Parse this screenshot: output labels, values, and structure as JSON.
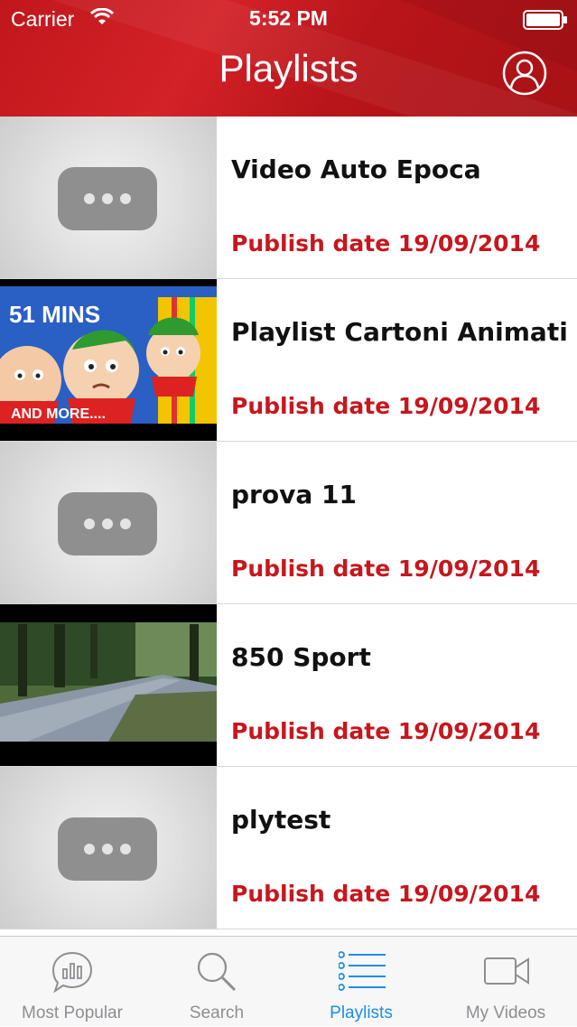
{
  "status_bar": {
    "carrier": "Carrier",
    "time": "5:52 PM"
  },
  "header": {
    "title": "Playlists",
    "profile_icon": "user-circle-icon"
  },
  "colors": {
    "accent": "#c8161d",
    "header": "#c0171c",
    "tab_active": "#1a8ee6",
    "tab_inactive": "#8e8e93"
  },
  "playlists": [
    {
      "title": "Video Auto Epoca",
      "date": "Publish date 19/09/2014",
      "thumbnail": "placeholder"
    },
    {
      "title": "Playlist Cartoni Animati",
      "date": "Publish date 19/09/2014",
      "thumbnail": "cartoon",
      "thumb_caption_top": "51 MINS",
      "thumb_caption_bottom": "AND MORE...."
    },
    {
      "title": "prova 11",
      "date": "Publish date 19/09/2014",
      "thumbnail": "placeholder"
    },
    {
      "title": "850 Sport",
      "date": "Publish date 19/09/2014",
      "thumbnail": "road"
    },
    {
      "title": "plytest",
      "date": "Publish date 19/09/2014",
      "thumbnail": "placeholder"
    }
  ],
  "tabs": [
    {
      "label": "Most Popular",
      "icon": "chat-chart-icon",
      "active": false
    },
    {
      "label": "Search",
      "icon": "search-icon",
      "active": false
    },
    {
      "label": "Playlists",
      "icon": "list-icon",
      "active": true
    },
    {
      "label": "My Videos",
      "icon": "video-camera-icon",
      "active": false
    }
  ]
}
